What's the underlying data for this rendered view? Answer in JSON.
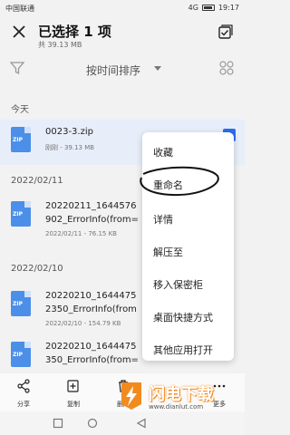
{
  "statusbar": {
    "carrier": "中国联通",
    "signal": "4G",
    "time": "19:17"
  },
  "header": {
    "title": "已选择 1 项",
    "subtitle": "共 39.13 MB"
  },
  "sortbar": {
    "label": "按时间排序"
  },
  "sections": [
    {
      "label": "今天"
    },
    {
      "label": "2022/02/11"
    },
    {
      "label": "2022/02/10"
    }
  ],
  "files": [
    {
      "line1": "0023-3.zip",
      "line2": "",
      "meta": "刚刚 - 39.13 MB",
      "selected": true
    },
    {
      "line1": "20220211_1644576",
      "line2": "902_ErrorInfo(from=",
      "meta": "2022/02/11 - 76.15 KB",
      "selected": false
    },
    {
      "line1": "20220210_1644475",
      "line2": "2350_ErrorInfo(from",
      "meta": "2022/02/10 - 154.79 KB",
      "selected": false
    },
    {
      "line1": "20220210_1644475",
      "line2": "350_ErrorInfo(from=",
      "meta": "",
      "selected": false
    }
  ],
  "menu": {
    "items": [
      "收藏",
      "重命名",
      "详情",
      "解压至",
      "移入保密柜",
      "桌面快捷方式",
      "其他应用打开"
    ]
  },
  "bottom_actions": [
    {
      "label": "分享",
      "icon": "share-icon"
    },
    {
      "label": "复制",
      "icon": "copy-icon"
    },
    {
      "label": "删除",
      "icon": "delete-icon"
    },
    {
      "label": "更多",
      "icon": "more-icon"
    }
  ],
  "watermark": {
    "main": "闪电下载",
    "url": "www.dianlut.com"
  },
  "colors": {
    "accent": "#2a6ef0",
    "file_icon": "#4b8fe8",
    "watermark": "#f28a1e"
  }
}
